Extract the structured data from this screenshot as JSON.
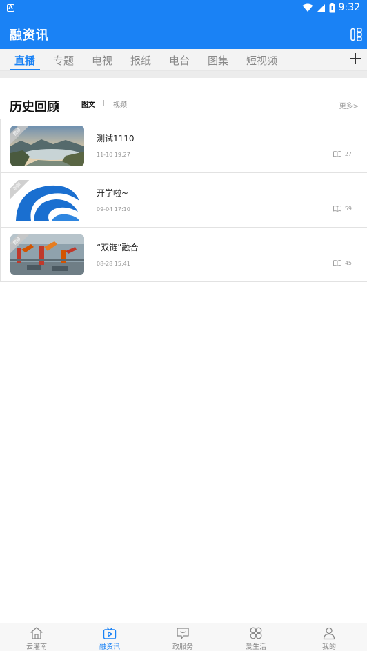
{
  "status_bar": {
    "time": "9:32",
    "notification_glyph": "A"
  },
  "app": {
    "title": "融资讯"
  },
  "tabs": [
    {
      "label": "直播",
      "active": true
    },
    {
      "label": "专题",
      "active": false
    },
    {
      "label": "电视",
      "active": false
    },
    {
      "label": "报纸",
      "active": false
    },
    {
      "label": "电台",
      "active": false
    },
    {
      "label": "图集",
      "active": false
    },
    {
      "label": "短视频",
      "active": false
    }
  ],
  "section": {
    "heading": "历史回顾",
    "sub_tabs": [
      {
        "label": "图文",
        "active": true
      },
      {
        "label": "视频",
        "active": false
      }
    ],
    "more_label": "更多>"
  },
  "items": [
    {
      "badge": "回顾",
      "title": "测试1110",
      "date": "11-10 19:27",
      "views": "27",
      "thumb_icon": "landscape-image"
    },
    {
      "badge": "回顾",
      "title": "开学啦~",
      "date": "09-04 17:10",
      "views": "59",
      "thumb_icon": "blue-logo-image"
    },
    {
      "badge": "回顾",
      "title": "“双链”融合",
      "date": "08-28 15:41",
      "views": "45",
      "thumb_icon": "robot-factory-image"
    }
  ],
  "bottom_nav": [
    {
      "label": "云灌南",
      "icon": "home-icon",
      "active": false
    },
    {
      "label": "融资讯",
      "icon": "tv-play-icon",
      "active": true
    },
    {
      "label": "政服务",
      "icon": "chat-service-icon",
      "active": false
    },
    {
      "label": "爱生活",
      "icon": "grid-clover-icon",
      "active": false
    },
    {
      "label": "我的",
      "icon": "person-icon",
      "active": false
    }
  ],
  "colors": {
    "accent": "#1a82f5",
    "tab_bar_bg": "#f3f3f3",
    "muted_text": "#999999"
  }
}
